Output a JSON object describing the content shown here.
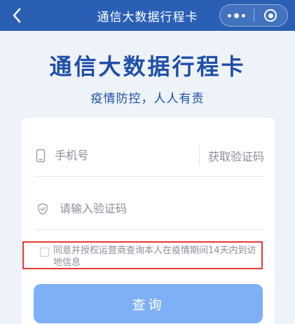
{
  "navbar": {
    "title": "通信大数据行程卡",
    "background": "#2a5fb5",
    "back_icon": "chevron-left-icon",
    "more_icon": "more-dots-icon",
    "close_icon": "target-close-icon"
  },
  "hero": {
    "title": "通信大数据行程卡",
    "subtitle": "疫情防控，人人有责",
    "color": "#1f4fa8"
  },
  "form": {
    "phone_placeholder": "手机号",
    "phone_icon": "phone-icon",
    "get_code_label": "获取验证码",
    "code_placeholder": "请输入验证码",
    "code_icon": "shield-icon",
    "agreement_text": "同意并授权运营商查询本人在疫情期间14天内到访地信息",
    "agreement_checked": false,
    "highlight_color": "#e53935",
    "query_label": "查询",
    "query_color": "#7fb0f5"
  }
}
